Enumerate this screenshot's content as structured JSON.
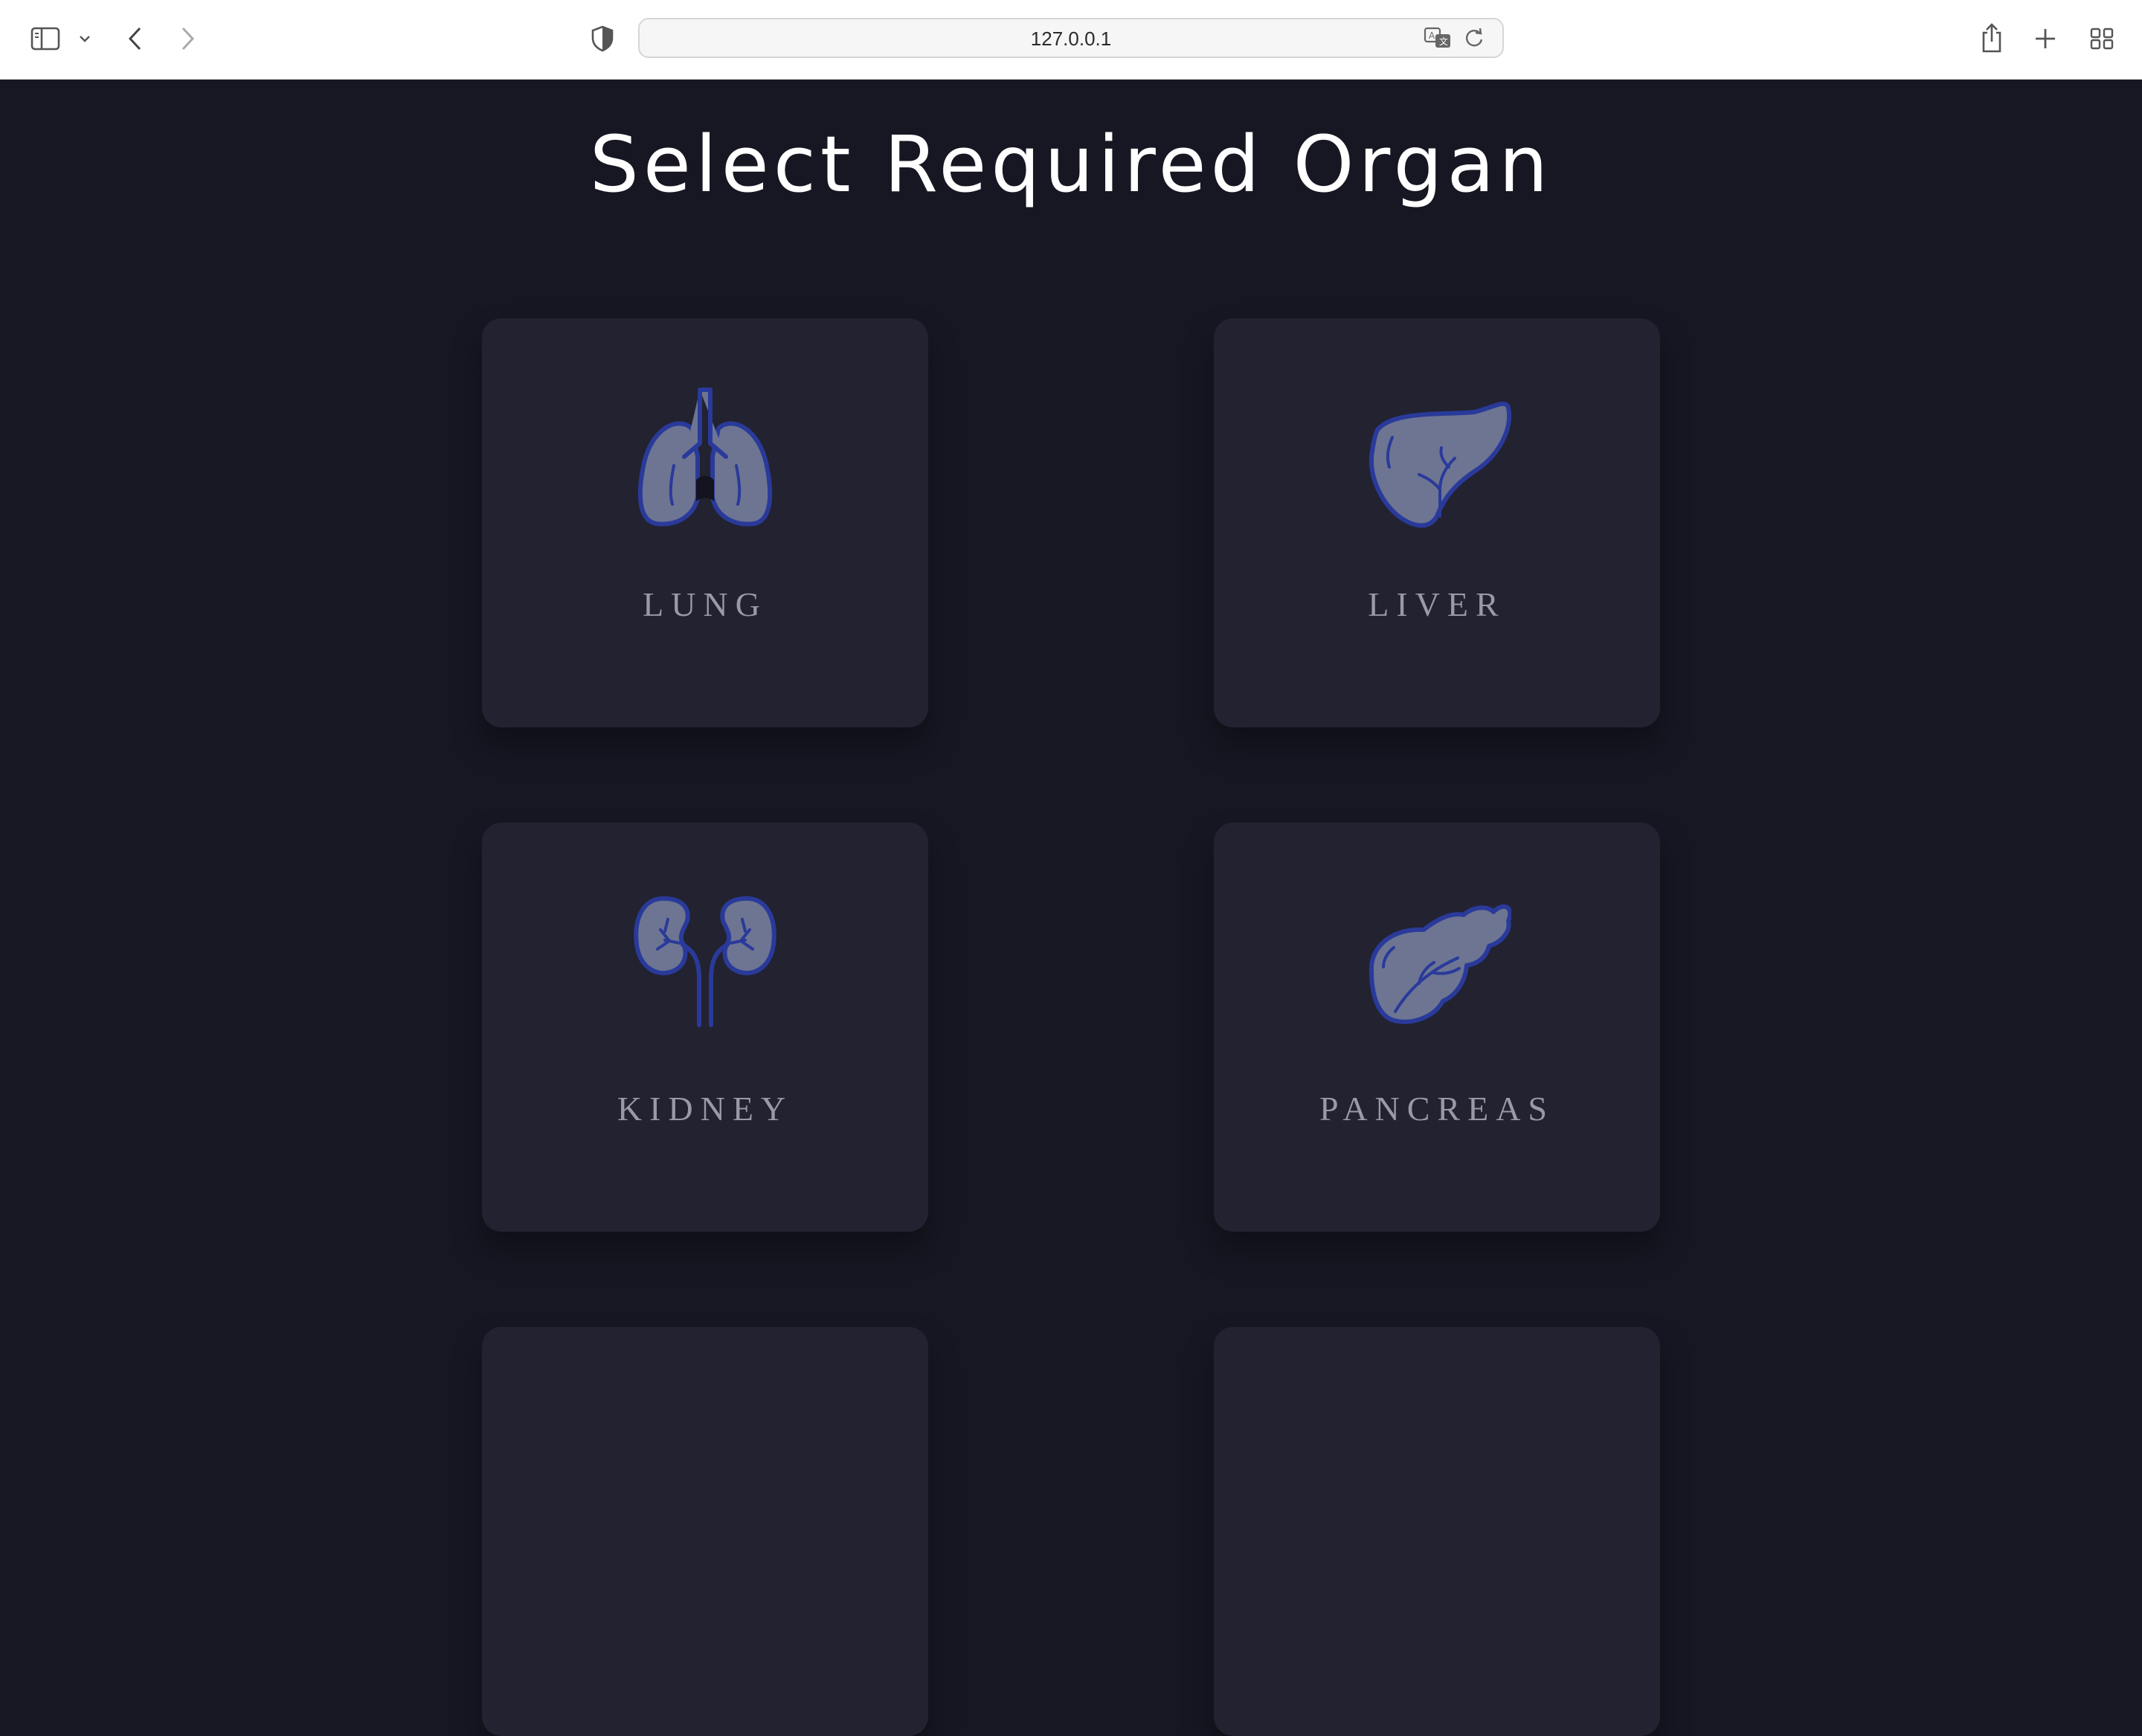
{
  "browser": {
    "url": "127.0.0.1",
    "icons": {
      "sidebar": "sidebar-icon",
      "dropdown": "chevron-down-icon",
      "back": "back-icon",
      "forward": "forward-icon",
      "shield": "shield-icon",
      "translate": "translate-icon",
      "reload": "reload-icon",
      "share": "share-icon",
      "new_tab": "plus-icon",
      "tabs": "tab-overview-icon"
    }
  },
  "page": {
    "title": "Select Required Organ"
  },
  "organs": [
    {
      "label": "LUNG",
      "icon": "lungs-icon"
    },
    {
      "label": "LIVER",
      "icon": "liver-icon"
    },
    {
      "label": "KIDNEY",
      "icon": "kidneys-icon"
    },
    {
      "label": "PANCREAS",
      "icon": "pancreas-icon"
    }
  ],
  "colors": {
    "background": "#171723",
    "card": "#222230",
    "icon_fill": "#6d7593",
    "icon_stroke": "#2a3a9a",
    "label": "#9a9aa6"
  }
}
